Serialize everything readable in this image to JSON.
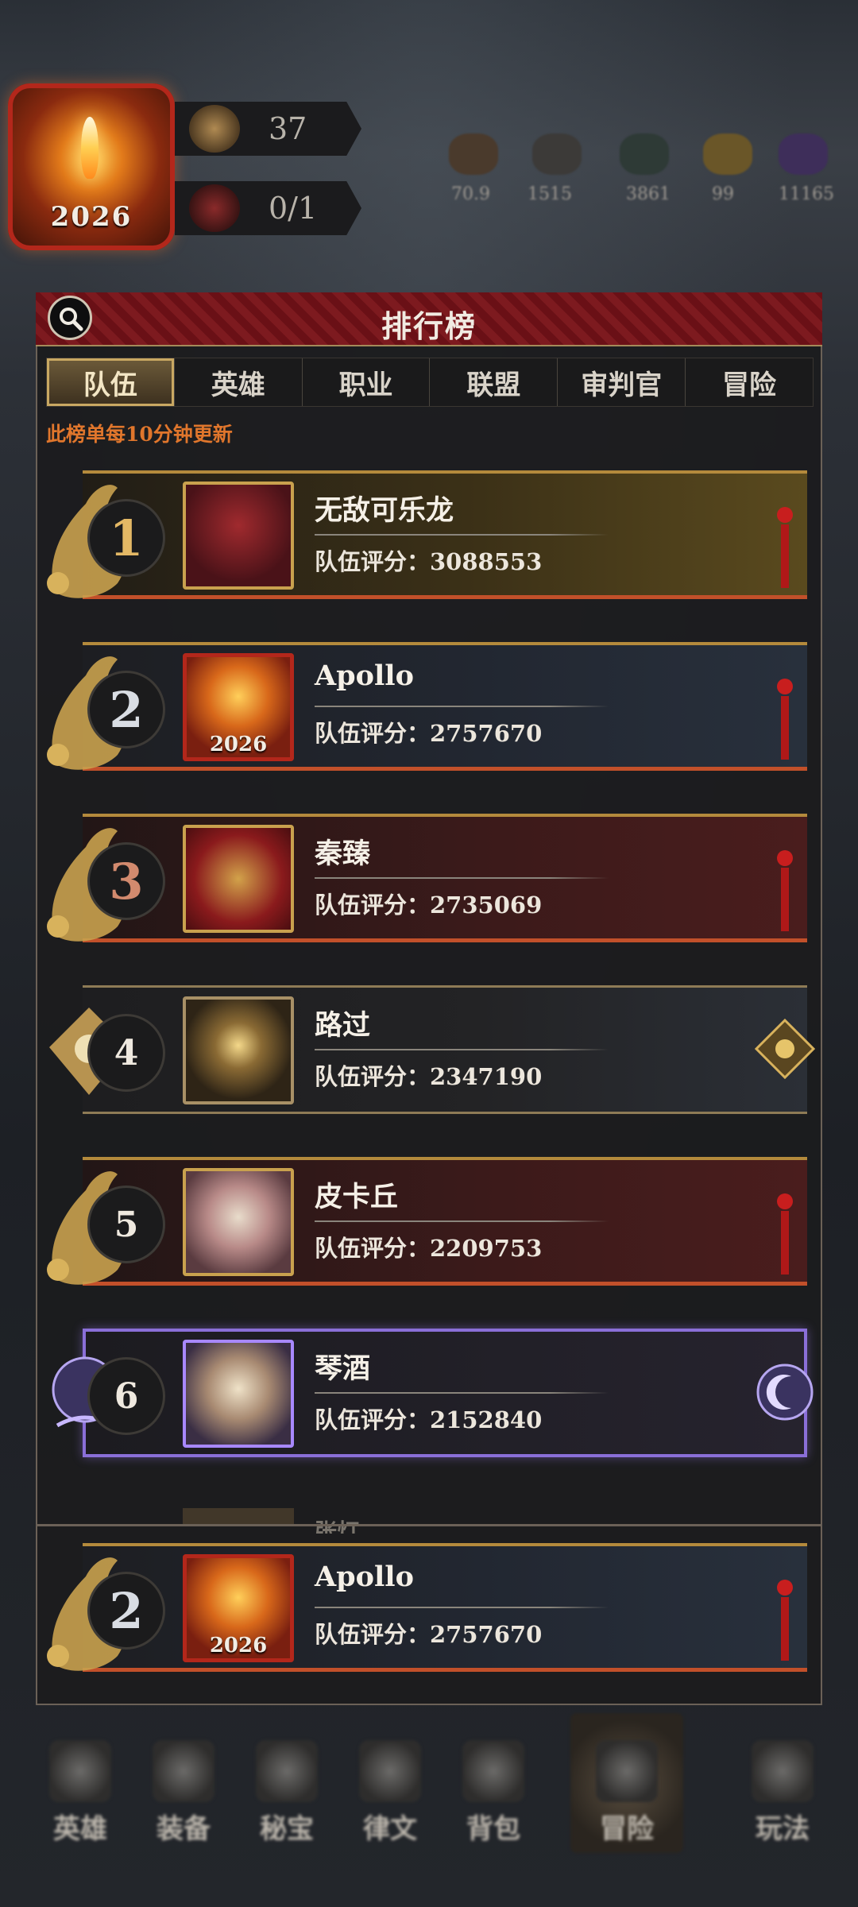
{
  "hud": {
    "avatar_year": "2026",
    "chip1_value": "37",
    "chip2_value": "0/1",
    "resources": [
      "70.9",
      "1515",
      "3861",
      "99",
      "11165"
    ]
  },
  "panel": {
    "title": "排行榜",
    "tabs": [
      "队伍",
      "英雄",
      "职业",
      "联盟",
      "审判官",
      "冒险"
    ],
    "active_tab": "队伍",
    "note": "此榜单每10分钟更新"
  },
  "rows": [
    {
      "rank": "1",
      "name": "无敌可乐龙",
      "score": "队伍评分：3088553"
    },
    {
      "rank": "2",
      "name": "Apollo",
      "score": "队伍评分：2757670"
    },
    {
      "rank": "3",
      "name": "秦臻",
      "score": "队伍评分：2735069"
    },
    {
      "rank": "4",
      "name": "路过",
      "score": "队伍评分：2347190"
    },
    {
      "rank": "5",
      "name": "皮卡丘",
      "score": "队伍评分：2209753"
    },
    {
      "rank": "6",
      "name": "琴酒",
      "score": "队伍评分：2152840"
    }
  ],
  "partial_row_name": "张灯",
  "my_row": {
    "rank": "2",
    "name": "Apollo",
    "score": "队伍评分：2757670"
  },
  "bottom_nav": [
    "英雄",
    "装备",
    "秘宝",
    "律文",
    "背包",
    "冒险",
    "玩法"
  ],
  "colors": {
    "note": "#e0762c",
    "gold": "#c9a14e",
    "purple": "#8a6fd8",
    "head": "#6a1016"
  }
}
